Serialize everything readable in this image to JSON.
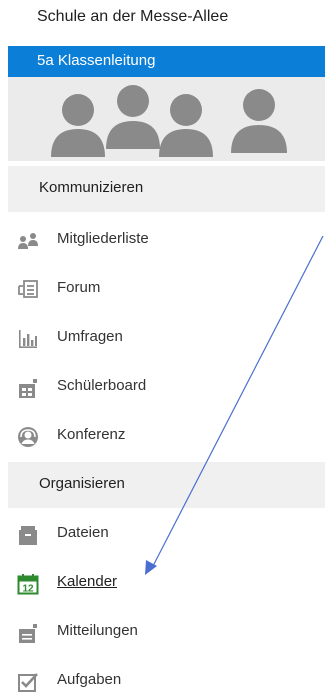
{
  "header": {
    "school_name": "Schule an der Messe-Allee",
    "group_name": "5a Klassenleitung"
  },
  "colors": {
    "group_bar": "#0b7fd8",
    "icon_gray": "#8a8a8a",
    "calendar_green": "#2f8a2f",
    "arrow_blue": "#4a6fd1"
  },
  "sections": [
    {
      "title": "Kommunizieren",
      "items": [
        {
          "label": "Mitgliederliste",
          "icon": "members-icon"
        },
        {
          "label": "Forum",
          "icon": "forum-icon"
        },
        {
          "label": "Umfragen",
          "icon": "poll-icon"
        },
        {
          "label": "Schülerboard",
          "icon": "board-icon"
        },
        {
          "label": "Konferenz",
          "icon": "conference-icon"
        }
      ]
    },
    {
      "title": "Organisieren",
      "items": [
        {
          "label": "Dateien",
          "icon": "files-icon"
        },
        {
          "label": "Kalender",
          "icon": "calendar-icon",
          "calendar_day": "12"
        },
        {
          "label": "Mitteilungen",
          "icon": "notices-icon"
        },
        {
          "label": "Aufgaben",
          "icon": "tasks-icon"
        }
      ]
    }
  ]
}
